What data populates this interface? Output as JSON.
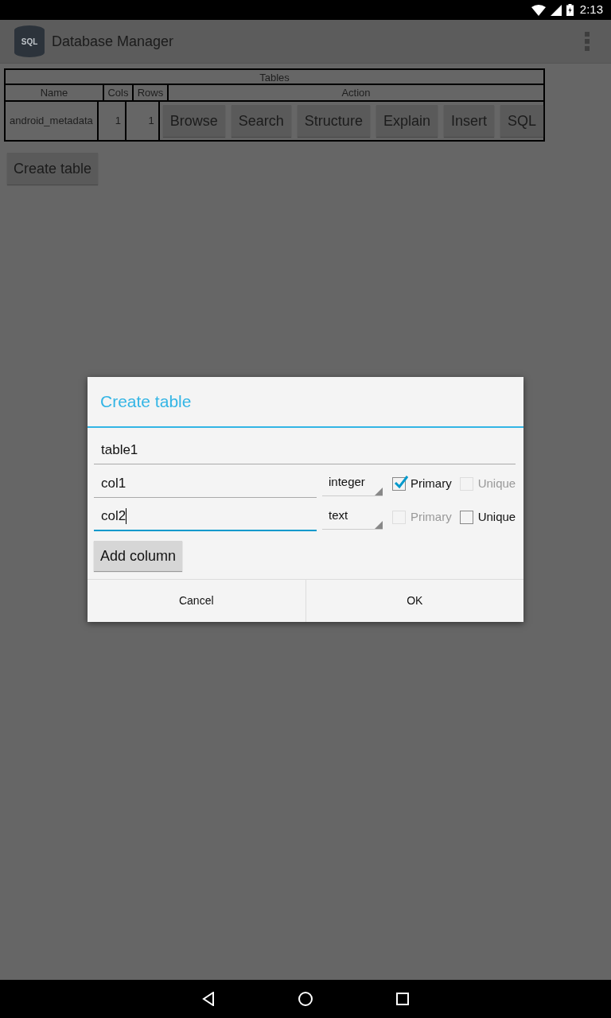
{
  "status_bar": {
    "time": "2:13"
  },
  "app_bar": {
    "title": "Database Manager",
    "logo_text": "SQL"
  },
  "tables": {
    "caption": "Tables",
    "columns": [
      "Name",
      "Cols",
      "Rows",
      "Action"
    ],
    "rows": [
      {
        "name": "android_metadata",
        "cols": "1",
        "rows": "1",
        "actions": [
          "Browse",
          "Search",
          "Structure",
          "Explain",
          "Insert",
          "SQL"
        ]
      }
    ]
  },
  "create_table_button": "Create table",
  "dialog": {
    "title": "Create table",
    "table_name": {
      "value": "table1",
      "focused": false
    },
    "columns": [
      {
        "name": "col1",
        "focused": false,
        "type": "integer",
        "primary": {
          "label": "Primary",
          "checked": true,
          "disabled": false
        },
        "unique": {
          "label": "Unique",
          "checked": false,
          "disabled": true
        }
      },
      {
        "name": "col2",
        "focused": true,
        "type": "text",
        "primary": {
          "label": "Primary",
          "checked": false,
          "disabled": true
        },
        "unique": {
          "label": "Unique",
          "checked": false,
          "disabled": false
        }
      }
    ],
    "add_column": "Add column",
    "buttons": [
      "Cancel",
      "OK"
    ]
  }
}
